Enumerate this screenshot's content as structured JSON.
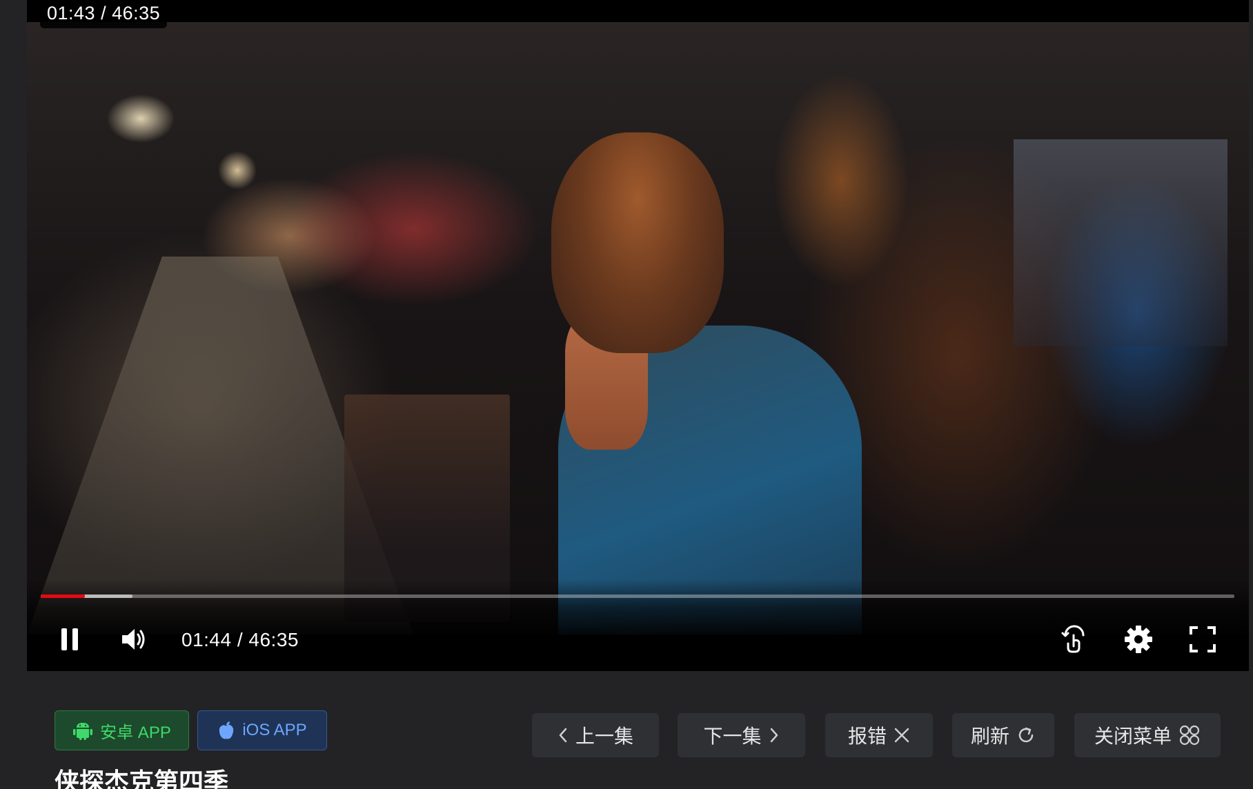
{
  "player": {
    "overlay_time": "01:43 / 46:35",
    "current_time": "01:44 / 46:35",
    "progress_played_fraction": 0.037,
    "progress_buffered_fraction": 0.077,
    "icons": {
      "play_pause": "pause-icon",
      "volume": "volume-icon",
      "gesture": "gesture-icon",
      "settings": "gear-icon",
      "fullscreen": "fullscreen-icon"
    },
    "accent_color": "#e50914"
  },
  "apps": {
    "android_label": "安卓 APP",
    "ios_label": "iOS APP",
    "android_color": "#3ed96a",
    "ios_color": "#6ea6ff"
  },
  "nav": {
    "prev_label": "上一集",
    "next_label": "下一集",
    "report_label": "报错",
    "refresh_label": "刷新",
    "close_menu_label": "关闭菜单"
  },
  "title": "侠探杰克第四季"
}
